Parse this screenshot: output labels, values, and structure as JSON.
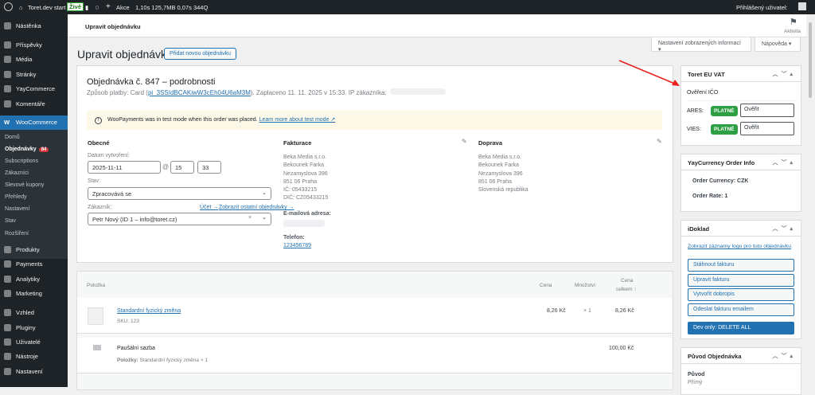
{
  "adminbar": {
    "site": "Toret.dev start",
    "live": "Živě",
    "comments": "0",
    "new": "Akce",
    "stats": "1,10s  125,7MB  0,07s  344Q",
    "user": "Přihlášený uživatel:"
  },
  "sidebar": {
    "top": [
      "Nástěnka",
      "Příspěvky",
      "Média",
      "Stránky",
      "YayCommerce",
      "Komentáře"
    ],
    "woo": "WooCommerce",
    "sub": [
      "Domů",
      "Objednávky",
      "Subscriptions",
      "Zákazníci",
      "Slevové kupony",
      "Přehledy",
      "Nastavení",
      "Stav",
      "Rozšíření"
    ],
    "orders_badge": "84",
    "bottom": [
      "Produkty",
      "Payments",
      "Analytiky",
      "Marketing",
      "Vzhled",
      "Pluginy",
      "Uživatelé",
      "Nástroje",
      "Nastavení"
    ]
  },
  "header": {
    "title": "Upravit objednávku",
    "activity": "Aktivita",
    "screen_options": "Nastavení zobrazených informací ▾",
    "help": "Nápověda ▾"
  },
  "page": {
    "title": "Upravit objednávku",
    "add_new": "Přidat novou objednávku"
  },
  "order": {
    "heading": "Objednávka č. 847 – podrobnosti",
    "payment_prefix": "Způsob platby: Card (",
    "payment_id": "pi_3SSIdBCAKiwW3cEh04U6aM3M",
    "payment_suffix": "). Zaplaceno 11. 11. 2025 v 15:33. IP zákazníka:",
    "notice": "WooPayments was in test mode when this order was placed.",
    "notice_link": "Learn more about test mode ↗",
    "general": {
      "title": "Obecné",
      "date_label": "Datum vytvoření:",
      "date": "2025-11-11",
      "hour": "15",
      "minute": "33",
      "status_label": "Stav:",
      "status": "Zpracovává se",
      "customer_label": "Zákazník:",
      "account_link": "Účet →",
      "other_orders_link": "Zobrazit ostatní objednávky →",
      "customer": "Petr Nový (ID 1 – info@toret.cz)"
    },
    "billing": {
      "title": "Fakturace",
      "lines": [
        "Beka Media s.r.o.",
        "Bekounek Farka",
        "Nezamyslova 396",
        "851 06 Praha",
        "IČ: 05433215",
        "DIČ: CZ05433215"
      ],
      "email_label": "E-mailová adresa:",
      "phone_label": "Telefon:",
      "phone": "123456789"
    },
    "shipping": {
      "title": "Doprava",
      "lines": [
        "Beka Media s.r.o.",
        "Bekounek Farka",
        "Nezamyslova 396",
        "851 06 Praha",
        "Slovenská republika"
      ]
    }
  },
  "items": {
    "headers": {
      "item": "Položka",
      "price": "Cena",
      "qty": "Množství",
      "total1": "Cena",
      "total2": "celkem ↑"
    },
    "rows": [
      {
        "name": "Standardní fyzický změna",
        "sku": "SKU: 123",
        "price": "8,26 Kč",
        "qty": "× 1",
        "total": "8,26 Kč"
      }
    ],
    "shipping": {
      "name": "Paušální sazba",
      "items_label": "Položky:",
      "items": "Standardní fyzický změna × 1",
      "total": "100,00 Kč"
    }
  },
  "vat": {
    "title": "Toret EU VAT",
    "subtitle": "Ověření IČO",
    "ares": "ARES:",
    "vies": "VIES:",
    "status": "PLATNÉ",
    "verify": "Ověřit"
  },
  "yay": {
    "title": "YayCurrency Order Info",
    "currency": "Order Currency: CZK",
    "rate": "Order Rate: 1"
  },
  "idoklad": {
    "title": "iDoklad",
    "log_link": "Zobrazit záznamy logu pro tuto objednávku",
    "buttons": [
      "Stáhnout fakturu",
      "Upravit fakturu",
      "Vytvořit dobropis",
      "Odeslat fakturu emailem"
    ],
    "delete": "Dev only: DELETE ALL"
  },
  "origin": {
    "title": "Původ Objednávka",
    "label": "Původ",
    "value": "Přímý"
  }
}
